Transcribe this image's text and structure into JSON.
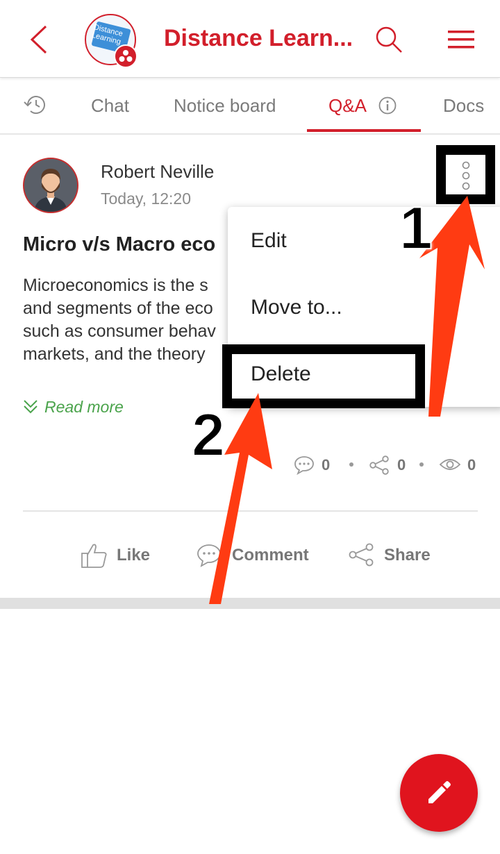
{
  "header": {
    "title": "Distance Learn...",
    "logo_text_line1": "Distance",
    "logo_text_line2": "Learning"
  },
  "tabs": [
    {
      "label": "Chat"
    },
    {
      "label": "Notice board"
    },
    {
      "label": "Q&A",
      "active": true
    },
    {
      "label": "Docs"
    }
  ],
  "post": {
    "author": "Robert Neville",
    "time": "Today, 12:20",
    "title": "Micro v/s Macro eco",
    "body": "Microeconomics is the s\nand segments of the eco\nsuch as consumer behav\nmarkets, and the theory",
    "read_more": "Read more",
    "comments_count": "0",
    "shares_count": "0",
    "views_count": "0",
    "actions": {
      "like": "Like",
      "comment": "Comment",
      "share": "Share"
    }
  },
  "menu": {
    "items": [
      "Edit",
      "Move to...",
      "Delete"
    ]
  },
  "annotations": {
    "step1": "1",
    "step2": "2"
  },
  "colors": {
    "brand": "#d21f2b",
    "read_more": "#4aa34b",
    "fab": "#e0141e",
    "arrow": "#ff3b12"
  }
}
